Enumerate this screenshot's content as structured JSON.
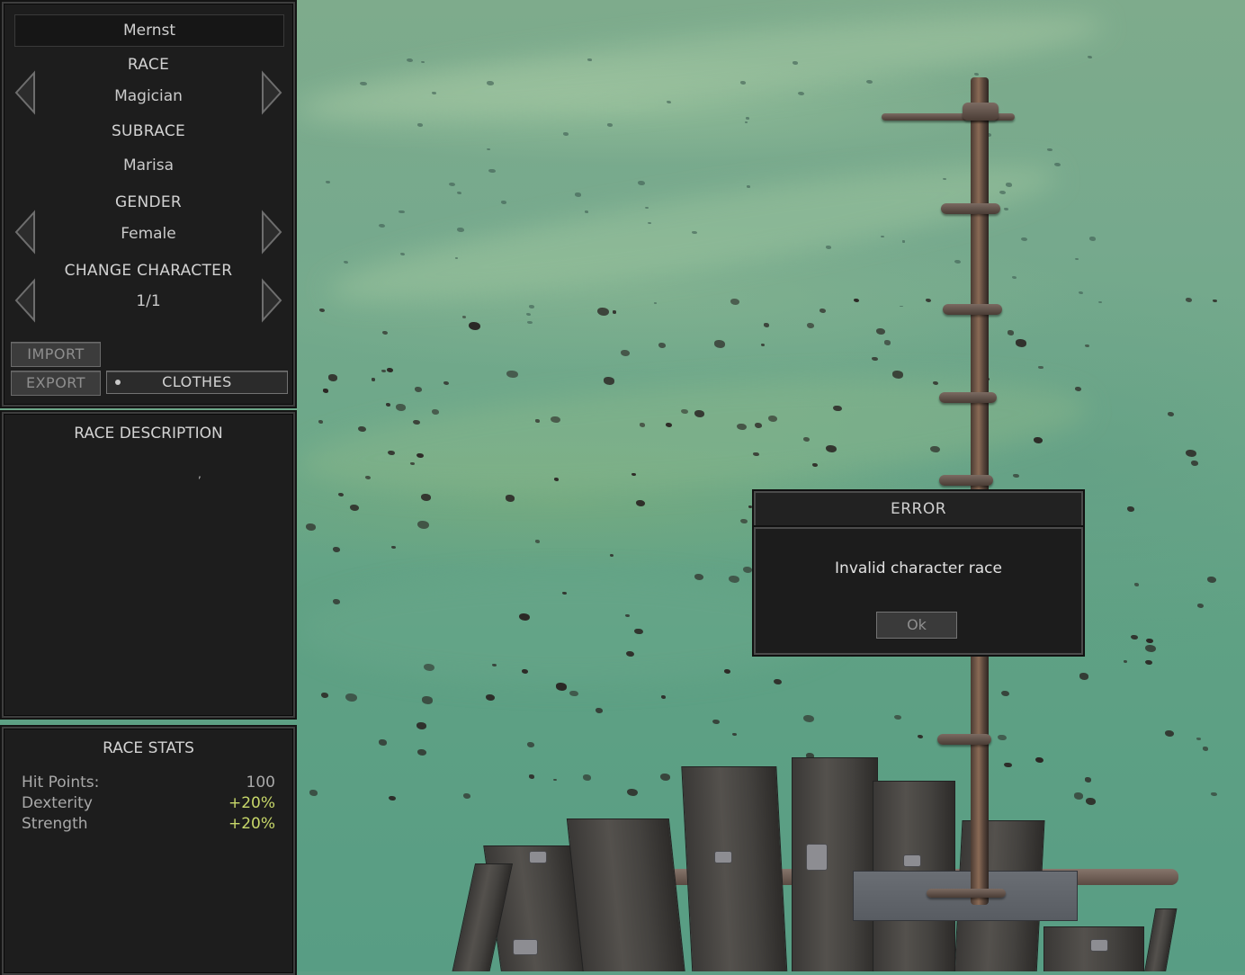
{
  "character": {
    "name": "Mernst",
    "race_label": "RACE",
    "race_value": "Magician",
    "subrace_label": "SUBRACE",
    "subrace_value": "Marisa",
    "gender_label": "GENDER",
    "gender_value": "Female",
    "change_label": "CHANGE CHARACTER",
    "change_value": "1/1"
  },
  "buttons": {
    "import": "IMPORT",
    "export": "EXPORT",
    "clothes": "CLOTHES"
  },
  "description": {
    "title": "RACE DESCRIPTION",
    "text": ","
  },
  "stats": {
    "title": "RACE STATS",
    "rows": [
      {
        "name": "Hit Points:",
        "value": "100"
      },
      {
        "name": "Dexterity",
        "value": "+20%"
      },
      {
        "name": "Strength",
        "value": "+20%"
      }
    ]
  },
  "dialog": {
    "title": "ERROR",
    "message": "Invalid character race",
    "ok": "Ok"
  },
  "icons": {
    "prev": "triangle-left-icon",
    "next": "triangle-right-icon"
  },
  "colors": {
    "panel_bg": "#1d1d1d",
    "bonus_text": "#c8d86a",
    "terrain": "#6da889"
  }
}
